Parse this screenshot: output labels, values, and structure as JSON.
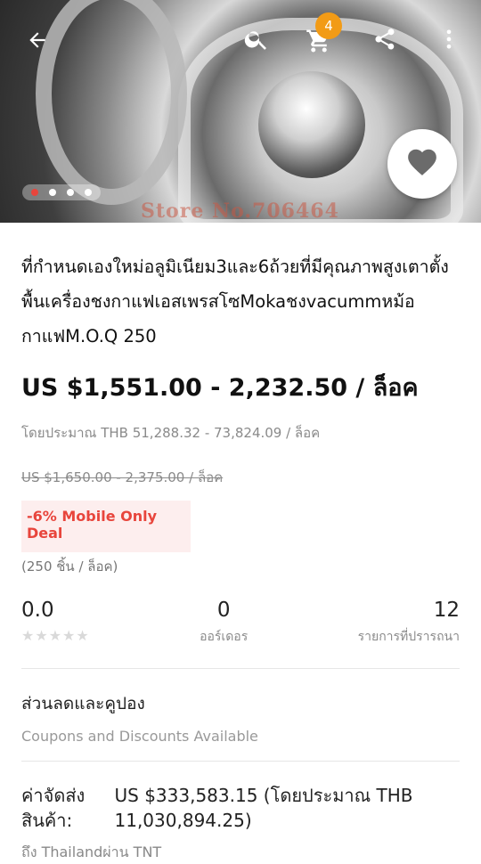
{
  "gallery": {
    "watermark": "Store No.706464",
    "cart_count": "4",
    "slide_count": 4,
    "active_slide": 1
  },
  "product": {
    "title": "ที่กำหนดเองใหม่อลูมิเนียม3และ6ถ้วยที่มีคุณภาพสูงเตาตั้งพื้นเครื่องชงกาแฟเอสเพรสโซMokaชงvacummหม้อกาแฟM.O.Q 250",
    "price": "US $1,551.00 - 2,232.50 / ล็อค",
    "approx_price": "โดยประมาณ THB 51,288.32 - 73,824.09 / ล็อค",
    "original_price": "US $1,650.00 - 2,375.00 / ล็อค",
    "deal_badge": "-6% Mobile Only Deal",
    "lot_info": "(250 ชิ้น / ล็อค)"
  },
  "stats": {
    "rating": "0.0",
    "orders": "0",
    "orders_label": "ออร์เดอร",
    "wishlist": "12",
    "wishlist_label": "รายการที่ปรารถนา"
  },
  "coupons": {
    "title": "ส่วนลดและคูปอง",
    "subtitle": "Coupons and Discounts Available"
  },
  "shipping": {
    "label": "ค่าจัดส่งสินค้า:",
    "value": "US $333,583.15 (โดยประมาณ THB 11,030,894.25)",
    "destination": "ถึง Thailandผ่าน TNT"
  },
  "icons": {
    "back": "back-arrow-icon",
    "search": "search-icon",
    "cart": "cart-icon",
    "share": "share-icon",
    "more": "more-vert-icon",
    "favorite": "heart-icon"
  },
  "colors": {
    "accent": "#e8453c",
    "badge": "#f29b16",
    "deal_bg": "#fdeeee"
  }
}
